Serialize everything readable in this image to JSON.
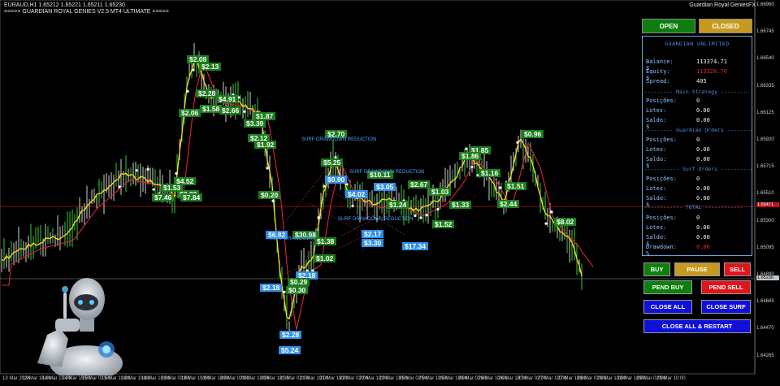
{
  "header": {
    "symbol_line": "EURAUD,H1  1.65212 1.65221 1.65211 1.65230",
    "ea_name": "===== GUARDIAN ROYAL GENIES V2.5 MT4 ULTIMATE =====",
    "brand": "Guardian Royal GeniesFX"
  },
  "price_axis": [
    "1.66960",
    "1.66745",
    "1.66540",
    "1.66335",
    "1.66125",
    "1.65920",
    "1.65715",
    "1.65510",
    "1.65300",
    "1.65095",
    "1.64890",
    "1.64685",
    "1.64470",
    "1.64265"
  ],
  "price_box_red": "1.65471",
  "price_box_current": "1.65230",
  "time_axis": [
    "13 Mar 2024",
    "13 Mar 18:00",
    "14 Mar 10:00",
    "14 Mar 18:00",
    "15 Mar 02:00",
    "15 Mar 10:00",
    "18 Mar 10:00",
    "18 Mar 18:00",
    "19 Mar 02:00",
    "19 Mar 10:00",
    "19 Mar 18:00",
    "20 Mar 02:00",
    "20 Mar 10:00",
    "20 Mar 18:00",
    "21 Mar 02:00",
    "21 Mar 10:00",
    "21 Mar 18:00",
    "22 Mar 02:00",
    "22 Mar 10:00",
    "22 Mar 18:00",
    "25 Mar 02:00",
    "25 Mar 10:00",
    "25 Mar 18:00",
    "26 Mar 02:00",
    "26 Mar 10:00",
    "26 Mar 18:00",
    "27 Mar 02:00",
    "27 Mar 10:00",
    "27 Mar 18:00",
    "28 Mar 02:00",
    "28 Mar 10:00",
    "28 Mar 18:00",
    "29 Mar 02:00",
    "29 Mar 10:00"
  ],
  "profit_tags": [
    {
      "t": "$2.08",
      "c": "g"
    },
    {
      "t": "$2.13",
      "c": "g"
    },
    {
      "t": "$2.28",
      "c": "g"
    },
    {
      "t": "$2.06",
      "c": "g"
    },
    {
      "t": "$1.58",
      "c": "g"
    },
    {
      "t": "$2.66",
      "c": "g"
    },
    {
      "t": "$4.91",
      "c": "g"
    },
    {
      "t": "$1.87",
      "c": "g"
    },
    {
      "t": "$3.39",
      "c": "g"
    },
    {
      "t": "$2.12",
      "c": "g"
    },
    {
      "t": "$1.92",
      "c": "g"
    },
    {
      "t": "$4.52",
      "c": "g"
    },
    {
      "t": "$1.53",
      "c": "g"
    },
    {
      "t": "$3.23",
      "c": "g"
    },
    {
      "t": "$7.46",
      "c": "g"
    },
    {
      "t": "$7.84",
      "c": "g"
    },
    {
      "t": "$0.20",
      "c": "g"
    },
    {
      "t": "$2.70",
      "c": "g"
    },
    {
      "t": "$5.25",
      "c": "g"
    },
    {
      "t": "$0.90",
      "c": "b"
    },
    {
      "t": "$10.11",
      "c": "g"
    },
    {
      "t": "$3.05",
      "c": "b"
    },
    {
      "t": "$4.02",
      "c": "b"
    },
    {
      "t": "$2.67",
      "c": "g"
    },
    {
      "t": "$1.24",
      "c": "g"
    },
    {
      "t": "$1.03",
      "c": "g"
    },
    {
      "t": "$1.52",
      "c": "g"
    },
    {
      "t": "$1.33",
      "c": "g"
    },
    {
      "t": "$1.85",
      "c": "g"
    },
    {
      "t": "$1.86",
      "c": "g"
    },
    {
      "t": "$1.16",
      "c": "g"
    },
    {
      "t": "$0.96",
      "c": "g"
    },
    {
      "t": "$1.51",
      "c": "g"
    },
    {
      "t": "$2.44",
      "c": "g"
    },
    {
      "t": "$8.02",
      "c": "g"
    },
    {
      "t": "$6.82",
      "c": "b"
    },
    {
      "t": "$30.98",
      "c": "g"
    },
    {
      "t": "$1.38",
      "c": "g"
    },
    {
      "t": "$2.17",
      "c": "b"
    },
    {
      "t": "$3.30",
      "c": "b"
    },
    {
      "t": "$17.34",
      "c": "b"
    },
    {
      "t": "$1.02",
      "c": "g"
    },
    {
      "t": "$2.18",
      "c": "b"
    },
    {
      "t": "$0.29",
      "c": "g"
    },
    {
      "t": "$0.30",
      "c": "g"
    },
    {
      "t": "$2.18",
      "c": "b"
    },
    {
      "t": "$2.28",
      "c": "b"
    },
    {
      "t": "$5.24",
      "c": "b"
    }
  ],
  "chart_notes": [
    "SURF DRAWDOWN REDUCTION",
    "SURF DRAWDOWN REDUCTION",
    "SURF DRAWDOWN",
    "SURF DRAWDOWN REDUCTION"
  ],
  "panel": {
    "open_label": "OPEN",
    "closed_label": "CLOSED",
    "title": "GUARDIAN UNLIMITED",
    "balance_label": "Balance: $",
    "balance_value": "113374.71",
    "equity_label": "Equity: $",
    "equity_value": "113326.76",
    "spread_label": "Spread:",
    "spread_value": "405",
    "main_header": "--------- Main Strategy ---------",
    "guardian_header": "--------- Guardian Orders ---------",
    "surf_header": "----------- Surf Orders -----------",
    "total_header": "------------ TOTAL ------------",
    "pos_label": "Posições:",
    "lots_label": "Lotes:",
    "saldo_label": "Saldo: $",
    "zero": "0",
    "zero_money": "0.00",
    "drawdown_label": "Drawdown: %",
    "drawdown_value": "0.00",
    "buttons": {
      "buy": "BUY",
      "pause": "PAUSE",
      "sell": "SELL",
      "pend_buy": "PEND BUY",
      "pend_sell": "PEND SELL",
      "close_all": "CLOSE ALL",
      "close_surf": "CLOSE SURF",
      "close_all_restart": "CLOSE ALL & RESTART"
    }
  },
  "colors": {
    "green_btn": "#0e7f0e",
    "gold_btn": "#c59a1e",
    "red_btn": "#e0141a",
    "blue_btn": "#1010d8",
    "panel_border": "#6ea2d8"
  }
}
